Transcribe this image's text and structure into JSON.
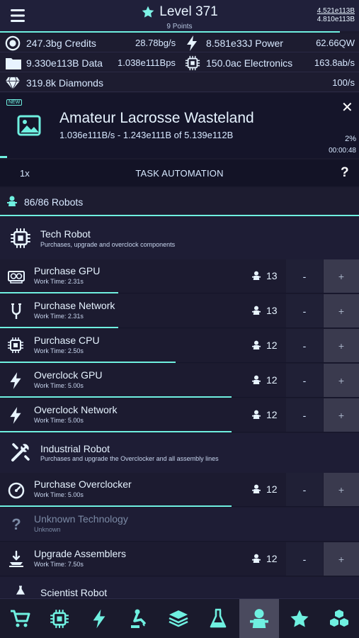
{
  "header": {
    "level": "Level 371",
    "points": "9 Points",
    "top_number": "4.521e113B",
    "bottom_number": "4.810e113B"
  },
  "resources": {
    "credits": {
      "value": "247.3bg Credits",
      "rate": "28.78bg/s",
      "icon": "credits-icon"
    },
    "power": {
      "value": "8.581e33J Power",
      "rate": "62.66QW",
      "icon": "lightning-icon"
    },
    "data": {
      "value": "9.330e113B Data",
      "rate": "1.038e111Bps",
      "icon": "folder-icon"
    },
    "electronics": {
      "value": "150.0ac Electronics",
      "rate": "163.8ab/s",
      "icon": "chip-icon"
    },
    "diamonds": {
      "value": "319.8k Diamonds",
      "rate": "100/s",
      "icon": "diamond-icon"
    }
  },
  "job": {
    "badge": "NEW",
    "title": "Amateur Lacrosse Wasteland",
    "subtitle": "1.036e111B/s - 1.243e111B of 5.139e112B",
    "percent": "2%",
    "time": "00:00:48",
    "progress": 0.02
  },
  "automation": {
    "speed": "1x",
    "title": "TASK AUTOMATION",
    "help": "?"
  },
  "robots": {
    "count": "86/86 Robots"
  },
  "sections": {
    "tech": {
      "title": "Tech Robot",
      "desc": "Purchases, upgrade and overclock components"
    },
    "industrial": {
      "title": "Industrial Robot",
      "desc": "Purchases and upgrade the Overclocker and all assembly lines"
    },
    "scientist": {
      "title": "Scientist Robot"
    }
  },
  "tasks": [
    {
      "name": "Purchase GPU",
      "work": "Work Time: 2.31s",
      "count": "13",
      "progress": 0.33,
      "icon": "gpu-icon"
    },
    {
      "name": "Purchase Network",
      "work": "Work Time: 2.31s",
      "count": "13",
      "progress": 0.33,
      "icon": "network-icon"
    },
    {
      "name": "Purchase CPU",
      "work": "Work Time: 2.50s",
      "count": "12",
      "progress": 0.49,
      "icon": "cpu-icon"
    },
    {
      "name": "Overclock GPU",
      "work": "Work Time: 5.00s",
      "count": "12",
      "progress": 0.645,
      "icon": "lightning-icon"
    },
    {
      "name": "Overclock Network",
      "work": "Work Time: 5.00s",
      "count": "12",
      "progress": 0.645,
      "icon": "lightning-icon"
    },
    {
      "name": "Purchase Overclocker",
      "work": "Work Time: 5.00s",
      "count": "12",
      "progress": 0.645,
      "icon": "gauge-icon"
    },
    {
      "name": "Unknown Technology",
      "work": "Unknown",
      "icon": "question-icon"
    },
    {
      "name": "Upgrade Assemblers",
      "work": "Work Time: 7.50s",
      "count": "12",
      "progress": 0.0,
      "icon": "assembler-icon"
    }
  ],
  "buttons": {
    "minus": "-",
    "plus": "+"
  },
  "nav": [
    "cart-icon",
    "chip-icon",
    "lightning-icon",
    "robot-arm-icon",
    "layers-icon",
    "flask-icon",
    "robot-icon",
    "star-icon",
    "cubes-icon"
  ],
  "colors": {
    "accent": "#6ff0e0",
    "background": "#1b1a2e"
  }
}
